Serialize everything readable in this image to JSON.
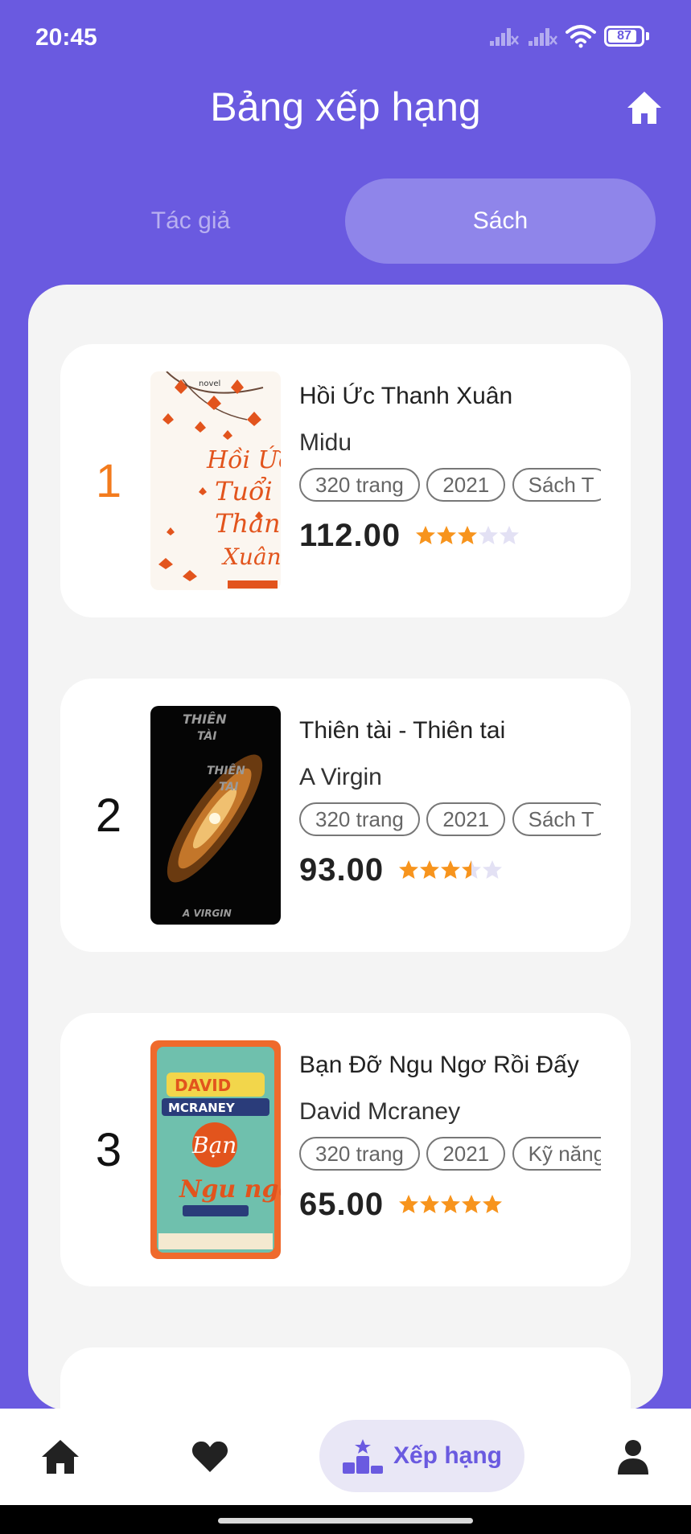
{
  "status_bar": {
    "time": "20:45",
    "battery": "87",
    "icons": [
      "signal-icon",
      "signal-icon",
      "wifi-icon",
      "battery-icon"
    ]
  },
  "header": {
    "title": "Bảng xếp hạng",
    "home_icon": "home-icon"
  },
  "tabs": [
    {
      "label": "Tác giả",
      "active": false
    },
    {
      "label": "Sách",
      "active": true
    }
  ],
  "books": [
    {
      "rank": "1",
      "title": "Hồi Ức Thanh Xuân",
      "author": "Midu",
      "tags": [
        "320 trang",
        "2021",
        "Sách T"
      ],
      "price": "112.00",
      "rating": 3
    },
    {
      "rank": "2",
      "title": "Thiên tài - Thiên tai",
      "author": "A Virgin",
      "tags": [
        "320 trang",
        "2021",
        "Sách T"
      ],
      "price": "93.00",
      "rating": 3.5
    },
    {
      "rank": "3",
      "title": "Bạn Đỡ Ngu Ngơ Rồi Đấy",
      "author": "David Mcraney",
      "tags": [
        "320 trang",
        "2021",
        "Kỹ năng"
      ],
      "price": "65.00",
      "rating": 5
    }
  ],
  "bottom_nav": {
    "items": [
      {
        "icon": "home-icon"
      },
      {
        "icon": "heart-icon"
      },
      {
        "icon": "podium-icon",
        "label": "Xếp hạng",
        "active": true
      },
      {
        "icon": "user-icon"
      }
    ]
  },
  "colors": {
    "primary": "#6a5ae0",
    "rank_first": "#f37b1d",
    "star": "#f7941d",
    "star_empty": "#e3e1f4"
  }
}
